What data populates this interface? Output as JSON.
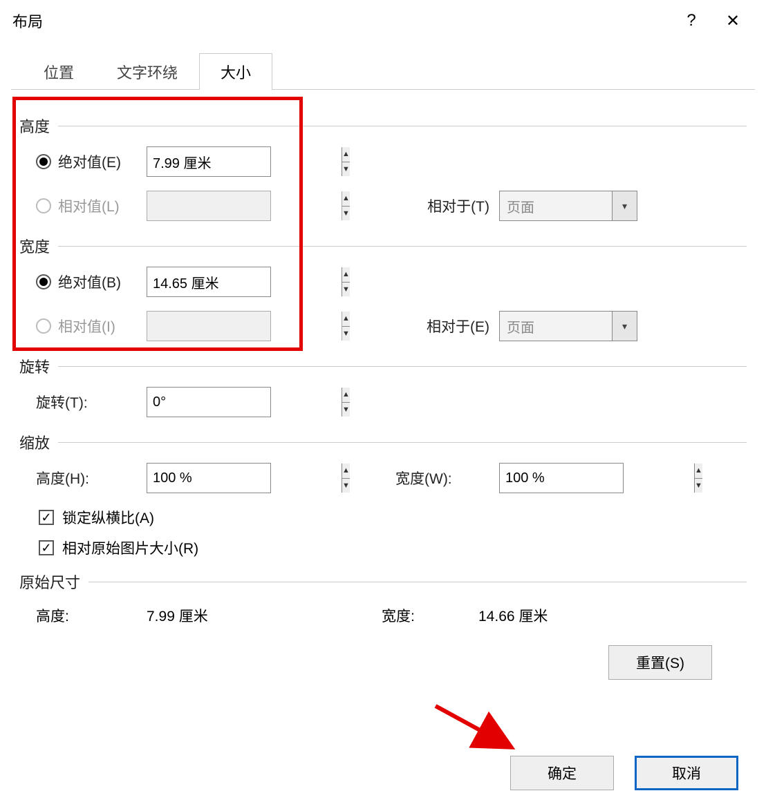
{
  "title": "布局",
  "help_symbol": "?",
  "close_symbol": "✕",
  "tabs": {
    "position": "位置",
    "textwrap": "文字环绕",
    "size": "大小"
  },
  "height": {
    "header": "高度",
    "absolute_label": "绝对值(E)",
    "absolute_value": "7.99 厘米",
    "relative_label": "相对值(L)",
    "relative_value": "",
    "relative_to_label": "相对于(T)",
    "relative_to_value": "页面"
  },
  "width": {
    "header": "宽度",
    "absolute_label": "绝对值(B)",
    "absolute_value": "14.65 厘米",
    "relative_label": "相对值(I)",
    "relative_value": "",
    "relative_to_label": "相对于(E)",
    "relative_to_value": "页面"
  },
  "rotation": {
    "header": "旋转",
    "label": "旋转(T):",
    "value": "0°"
  },
  "scale": {
    "header": "缩放",
    "height_label": "高度(H):",
    "height_value": "100 %",
    "width_label": "宽度(W):",
    "width_value": "100 %",
    "lock_aspect": "锁定纵横比(A)",
    "relative_original": "相对原始图片大小(R)"
  },
  "original": {
    "header": "原始尺寸",
    "height_label": "高度:",
    "height_value": "7.99 厘米",
    "width_label": "宽度:",
    "width_value": "14.66 厘米"
  },
  "buttons": {
    "reset": "重置(S)",
    "ok": "确定",
    "cancel": "取消"
  }
}
